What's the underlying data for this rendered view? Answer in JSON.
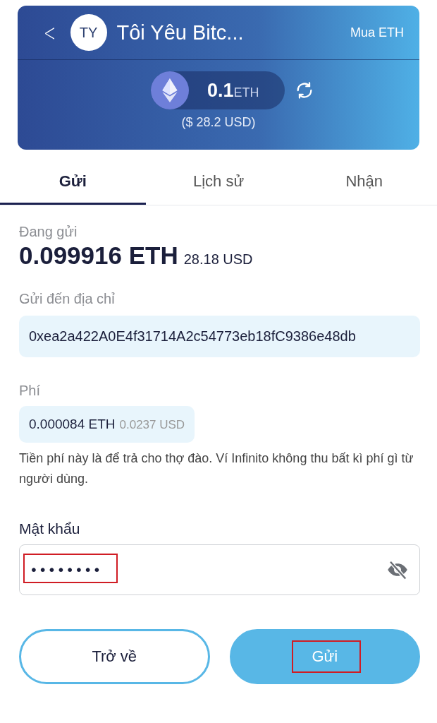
{
  "header": {
    "back": "<",
    "avatar": "TY",
    "title": "Tôi Yêu Bitc...",
    "action": "Mua ETH",
    "balance_amount": "0.1",
    "balance_unit": "ETH",
    "balance_usd": "($ 28.2 USD)"
  },
  "tabs": [
    {
      "label": "Gửi",
      "selected": true
    },
    {
      "label": "Lịch sử",
      "selected": false
    },
    {
      "label": "Nhận",
      "selected": false
    }
  ],
  "sending": {
    "label": "Đang gửi",
    "amount": "0.099916 ETH",
    "usd": "28.18 USD"
  },
  "address": {
    "label": "Gửi đến địa chỉ",
    "value": "0xea2a422A0E4f31714A2c54773eb18fC9386e48db"
  },
  "fee": {
    "label": "Phí",
    "amount": "0.000084 ETH",
    "usd": "0.0237 USD",
    "note": "Tiền phí này là để trả cho thợ đào. Ví Infinito không thu bất kì phí gì từ người dùng."
  },
  "password": {
    "label": "Mật khẩu",
    "value": "••••••••",
    "highlighted": true
  },
  "buttons": [
    {
      "label": "Trở về",
      "kind": "outline",
      "highlighted": false
    },
    {
      "label": "Gửi",
      "kind": "filled",
      "highlighted": true
    }
  ]
}
